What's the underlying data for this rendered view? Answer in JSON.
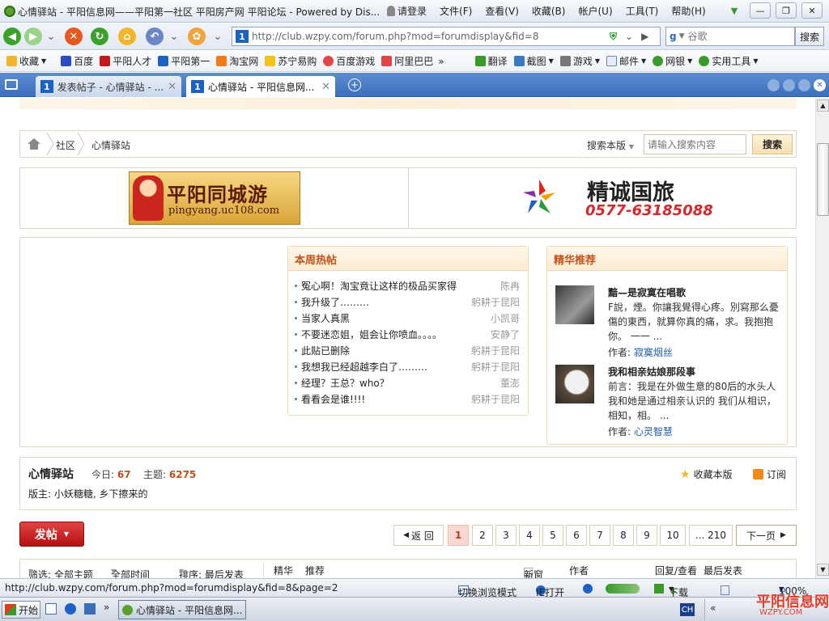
{
  "window": {
    "title": "心情驿站 - 平阳信息网——平阳第一社区 平阳房产网 平阳论坛 - Powered by Dis...",
    "login": "请登录",
    "menu": [
      "文件(F)",
      "查看(V)",
      "收藏(B)",
      "帐户(U)",
      "工具(T)",
      "帮助(H)"
    ]
  },
  "navbar": {
    "url": "http://club.wzpy.com/forum.php?mod=forumdisplay&fid=8",
    "search_placeholder": "谷歌",
    "search_button": "搜索"
  },
  "favorites": {
    "items": [
      "收藏",
      "百度",
      "平阳人才",
      "平阳第一",
      "淘宝网",
      "苏宁易购",
      "百度游戏",
      "阿里巴巴"
    ],
    "more": "»",
    "tools": [
      "翻译",
      "截图",
      "游戏",
      "邮件",
      "网银",
      "实用工具"
    ]
  },
  "tabs": [
    {
      "label": "发表帖子 - 心情驿站 - ..."
    },
    {
      "label": "心情驿站 - 平阳信息网..."
    }
  ],
  "breadcrumb": {
    "items": [
      "社区",
      "心情驿站"
    ],
    "search_label": "搜索本版",
    "search_placeholder": "请输入搜索内容",
    "search_button": "搜索"
  },
  "ads": {
    "left_title": "平阳同城游",
    "left_url": "pingyang.uc108.com",
    "right_title": "精诚国旅",
    "right_phone": "0577-63185088"
  },
  "hot": {
    "title": "本周热帖",
    "items": [
      {
        "title": "冤心啊！淘宝竟让这样的极品买家得",
        "author": "陈冉"
      },
      {
        "title": "我升级了………",
        "author": "躬耕于昆阳"
      },
      {
        "title": "当家人真黑",
        "author": "小凯哥"
      },
      {
        "title": "不要迷恋姐，姐会让你喷血。。。。",
        "author": "安静了"
      },
      {
        "title": "此贴已删除",
        "author": "躬耕于昆阳"
      },
      {
        "title": "我想我已经超越李白了………",
        "author": "躬耕于昆阳"
      },
      {
        "title": "经理？王总？who？",
        "author": "董澎"
      },
      {
        "title": "看看会是谁!!!!",
        "author": "躬耕于昆阳"
      }
    ]
  },
  "digest": {
    "title": "精华推荐",
    "author_label": "作者:",
    "items": [
      {
        "title": "黯—是寂寞在唱歌",
        "excerpt": "F說，煙。你讓我覺得心疼。別寫那么憂傷的東西，就算你真的痛，求。我抱抱你。 一一 ...",
        "author": "寂寞烟丝"
      },
      {
        "title": "我和相亲姑娘那段事",
        "excerpt": "前言：我是在外做生意的80后的水头人 我和她是通过相亲认识的 我们从相识，相知，相。 ...",
        "author": "心灵智慧"
      }
    ]
  },
  "forum": {
    "name": "心情驿站",
    "today_label": "今日:",
    "today_value": "67",
    "topics_label": "主题:",
    "topics_value": "6275",
    "moderators": "版主: 小妖糖糖, 乡下擦来的",
    "favorite": "收藏本版",
    "subscribe": "订阅"
  },
  "pagination": {
    "new_post": "发帖",
    "back": "返 回",
    "pages": [
      "1",
      "2",
      "3",
      "4",
      "5",
      "6",
      "7",
      "8",
      "9",
      "10",
      "... 210"
    ],
    "current": "1",
    "next": "下一页"
  },
  "filters": {
    "filter": "筛选: 全部主题",
    "time": "全部时间",
    "sort": "排序: 最后发表",
    "digest": "精华",
    "recommend": "推荐",
    "new_window": "新窗",
    "author": "作者",
    "replies": "回复/查看",
    "lastpost": "最后发表"
  },
  "status": {
    "url": "http://club.wzpy.com/forum.php?mod=forumdisplay&fid=8&page=2",
    "switch_mode": "切换浏览模式",
    "ie_open": "IE打开",
    "download": "下载",
    "zoom": "100%"
  },
  "taskbar": {
    "start": "开始",
    "item": "心情驿站 - 平阳信息网...",
    "lang": "CH"
  },
  "watermark": {
    "text": "平阳信息网",
    "sub": "WZPY.COM"
  },
  "colors": {
    "accent": "#c2511a",
    "brand_red": "#c51a1a",
    "link": "#1b5bb0"
  }
}
